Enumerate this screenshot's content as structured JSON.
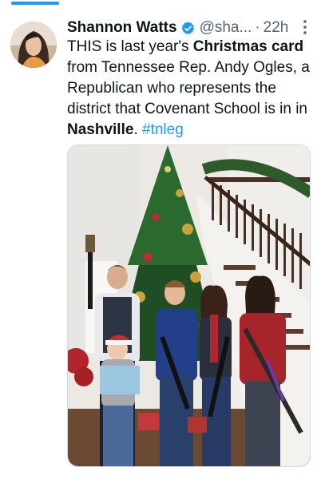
{
  "tweet": {
    "author_name": "Shannon Watts",
    "handle": "@sha...",
    "separator": "·",
    "timestamp": "22h",
    "text_parts": {
      "p1": "THIS is last year's ",
      "p2": "Christmas card",
      "p3": " from Tennessee Rep. Andy Ogles, a Republican who represents the district that Covenant School is in in ",
      "p4": "Nashville",
      "p5": ". ",
      "hashtag": "#tnleg"
    },
    "icons": {
      "verified": "verified-badge-icon",
      "more": "more-options-icon"
    }
  },
  "colors": {
    "accent": "#1d9bf0",
    "text": "#0f1419",
    "secondary_text": "#536471"
  }
}
